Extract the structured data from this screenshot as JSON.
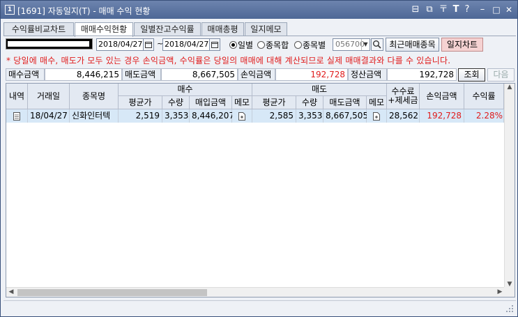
{
  "window": {
    "badge": "1",
    "title": "[1691] 자동일지(T) - 매매 수익 현황",
    "buttons": [
      "⊟",
      "⧉",
      "〒",
      "T",
      "?",
      "–",
      "□",
      "✕"
    ]
  },
  "tabs": [
    {
      "label": "수익률비교차트"
    },
    {
      "label": "매매수익현황"
    },
    {
      "label": "일별잔고수익률"
    },
    {
      "label": "매매총평"
    },
    {
      "label": "일지메모"
    }
  ],
  "toolbar": {
    "date_from": "2018/04/27",
    "date_to": "2018/04/27",
    "tilde": "~",
    "radios": [
      {
        "label": "일별",
        "checked": true
      },
      {
        "label": "종목합",
        "checked": false
      },
      {
        "label": "종목별",
        "checked": false
      }
    ],
    "code_value": "056700",
    "recent_button": "최근매매종목",
    "journal_chart_button": "일지차트"
  },
  "notice": "* 당일에 매수, 매도가 모두 있는 경우 손익금액, 수익률은 당일의 매매에 대해 계산되므로 실제 매매결과와 다를 수 있습니다.",
  "summary": {
    "buy_label": "매수금액",
    "buy_value": "8,446,215",
    "sell_label": "매도금액",
    "sell_value": "8,667,505",
    "pnl_label": "손익금액",
    "pnl_value": "192,728",
    "settle_label": "정산금액",
    "settle_value": "192,728",
    "query_button": "조회",
    "next_button": "다음"
  },
  "grid": {
    "headers": {
      "detail": "내역",
      "date": "거래일",
      "stock": "종목명",
      "buy_group": "매수",
      "sell_group": "매도",
      "fee_line1": "수수료",
      "fee_line2": "+제세금",
      "pnl": "손익금액",
      "rate": "수익률",
      "buy_avg": "평균가",
      "buy_qty": "수량",
      "buy_amount": "매입금액",
      "buy_memo": "메모",
      "sell_avg": "평균가",
      "sell_qty": "수량",
      "sell_amount": "매도금액",
      "sell_memo": "메모"
    },
    "rows": [
      {
        "date": "18/04/27",
        "stock": "신화인터텍",
        "buy_avg": "2,519",
        "buy_qty": "3,353",
        "buy_amount": "8,446,207",
        "sell_avg": "2,585",
        "sell_qty": "3,353",
        "sell_amount": "8,667,505",
        "fee": "28,562",
        "pnl": "192,728",
        "rate": "2.28%"
      }
    ]
  },
  "colors": {
    "accent_red": "#e01b1b",
    "titlebar": "#4d6796",
    "selected_row": "#d7e8f7"
  }
}
